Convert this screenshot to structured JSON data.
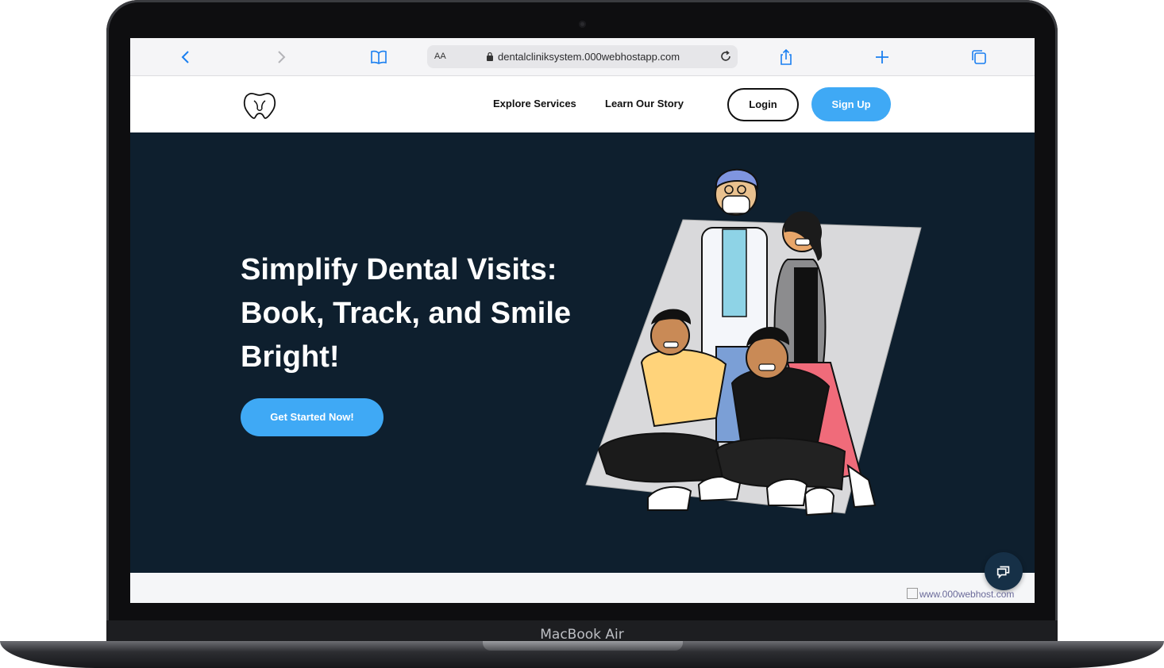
{
  "device": {
    "label": "MacBook Air"
  },
  "browser": {
    "text_size_label": "AA",
    "url": "dentalcliniksystem.000webhostapp.com",
    "icons": [
      "chevron-left-icon",
      "chevron-right-icon",
      "book-icon",
      "lock-icon",
      "reload-icon",
      "share-icon",
      "plus-icon",
      "tabs-icon"
    ]
  },
  "nav": {
    "links": [
      "Explore Services",
      "Learn Our Story"
    ],
    "login": "Login",
    "signup": "Sign Up"
  },
  "hero": {
    "headline": "Simplify Dental Visits: Book, Track, and Smile Bright!",
    "cta": "Get Started Now!"
  },
  "footer": {
    "host_badge": "www.000webhost.com"
  },
  "colors": {
    "hero_bg": "#0e1f2e",
    "accent": "#3fa9f5",
    "chat_button": "#163047"
  }
}
